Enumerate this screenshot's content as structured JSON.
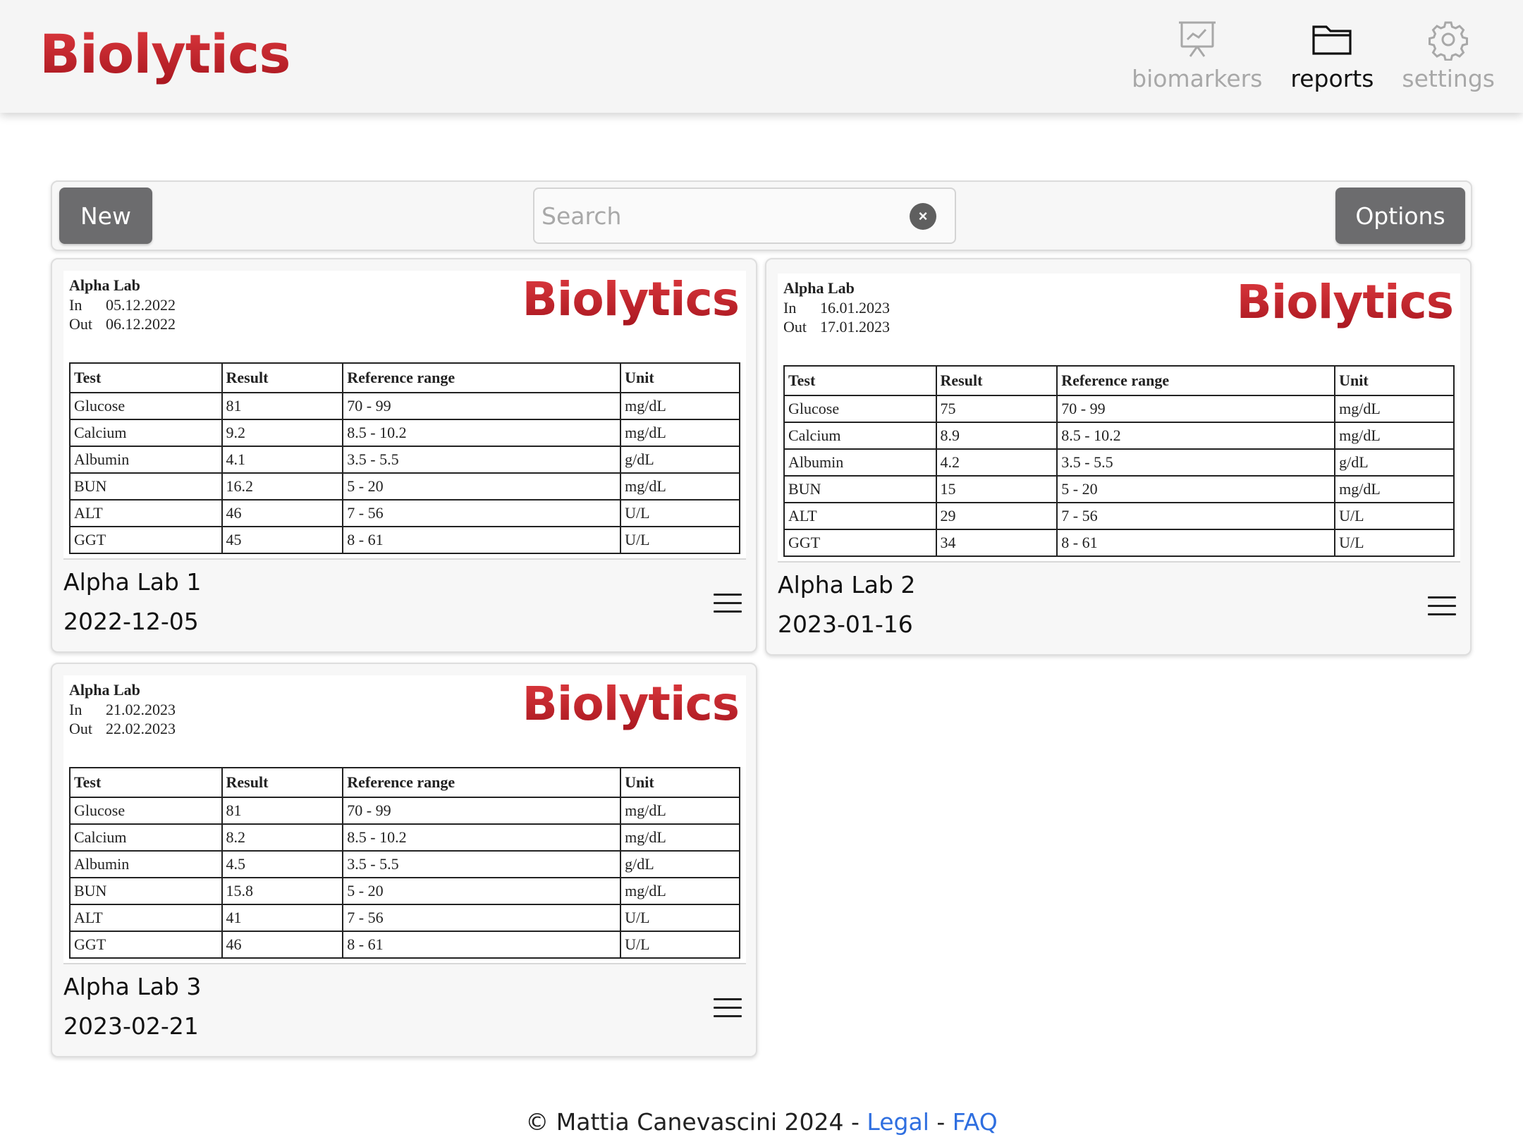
{
  "app": {
    "brand": "Biolytics"
  },
  "nav": {
    "items": [
      {
        "label": "biomarkers",
        "icon": "chart-board-icon",
        "active": false
      },
      {
        "label": "reports",
        "icon": "folder-icon",
        "active": true
      },
      {
        "label": "settings",
        "icon": "gear-icon",
        "active": false
      }
    ]
  },
  "toolbar": {
    "new_label": "New",
    "search_placeholder": "Search",
    "search_value": "",
    "clear_symbol": "×",
    "options_label": "Options"
  },
  "table_headers": [
    "Test",
    "Result",
    "Reference range",
    "Unit"
  ],
  "cards": [
    {
      "lab": "Alpha Lab",
      "in_label": "In",
      "in_date": "05.12.2022",
      "out_label": "Out",
      "out_date": "06.12.2022",
      "logo": "Biolytics",
      "rows": [
        [
          "Glucose",
          "81",
          "70 - 99",
          "mg/dL"
        ],
        [
          "Calcium",
          "9.2",
          "8.5 - 10.2",
          "mg/dL"
        ],
        [
          "Albumin",
          "4.1",
          "3.5 - 5.5",
          "g/dL"
        ],
        [
          "BUN",
          "16.2",
          "5 - 20",
          "mg/dL"
        ],
        [
          "ALT",
          "46",
          "7 - 56",
          "U/L"
        ],
        [
          "GGT",
          "45",
          "8 - 61",
          "U/L"
        ]
      ],
      "title": "Alpha Lab 1",
      "date": "2022-12-05"
    },
    {
      "lab": "Alpha Lab",
      "in_label": "In",
      "in_date": "16.01.2023",
      "out_label": "Out",
      "out_date": "17.01.2023",
      "logo": "Biolytics",
      "rows": [
        [
          "Glucose",
          "75",
          "70 - 99",
          "mg/dL"
        ],
        [
          "Calcium",
          "8.9",
          "8.5 - 10.2",
          "mg/dL"
        ],
        [
          "Albumin",
          "4.2",
          "3.5 - 5.5",
          "g/dL"
        ],
        [
          "BUN",
          "15",
          "5 - 20",
          "mg/dL"
        ],
        [
          "ALT",
          "29",
          "7 - 56",
          "U/L"
        ],
        [
          "GGT",
          "34",
          "8 - 61",
          "U/L"
        ]
      ],
      "title": "Alpha Lab 2",
      "date": "2023-01-16"
    },
    {
      "lab": "Alpha Lab",
      "in_label": "In",
      "in_date": "21.02.2023",
      "out_label": "Out",
      "out_date": "22.02.2023",
      "logo": "Biolytics",
      "rows": [
        [
          "Glucose",
          "81",
          "70 - 99",
          "mg/dL"
        ],
        [
          "Calcium",
          "8.2",
          "8.5 - 10.2",
          "mg/dL"
        ],
        [
          "Albumin",
          "4.5",
          "3.5 - 5.5",
          "g/dL"
        ],
        [
          "BUN",
          "15.8",
          "5 - 20",
          "mg/dL"
        ],
        [
          "ALT",
          "41",
          "7 - 56",
          "U/L"
        ],
        [
          "GGT",
          "46",
          "8 - 61",
          "U/L"
        ]
      ],
      "title": "Alpha Lab 3",
      "date": "2023-02-21"
    }
  ],
  "footer": {
    "copyright": "© Mattia Canevascini 2024 - ",
    "legal": "Legal",
    "separator": " - ",
    "faq": "FAQ"
  },
  "colors": {
    "brand_red": "#c8202a",
    "button_gray": "#6c6c6e",
    "link_blue": "#2f6fe0",
    "nav_inactive": "#a8a8a8"
  }
}
